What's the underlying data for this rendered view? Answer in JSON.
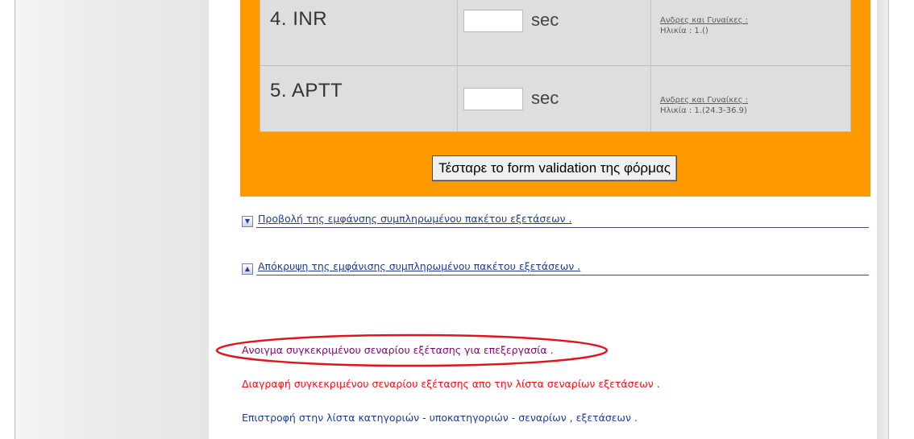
{
  "tests": [
    {
      "number": "4.",
      "name": "INR",
      "value": "",
      "unit": "sec",
      "ref_link": "Ανδρες και Γυναίκες :",
      "ref_range": "Ηλικία :  1.()"
    },
    {
      "number": "5.",
      "name": "APTT",
      "value": "",
      "unit": "sec",
      "ref_link": "Ανδρες και Γυναίκες :",
      "ref_range": "Ηλικία :  1.(24.3-36.9)"
    }
  ],
  "validate_button": "Τέσταρε το form validation της φόρμας",
  "toggles": {
    "show_label": "Προβολή της εμφάνσης συμπληρωμένου πακέτου εξετάσεων .",
    "hide_label": "Απόκρυψη της εμφάνισης συμπληρωμένου πακέτου εξετάσεων ."
  },
  "actions": {
    "open": "Ανοιγμα συγκεκριμένου σεναρίου εξέτασης για επεξεργασία .",
    "delete": "Διαγραφή συγκεκριμένου σεναρίου εξέτασης απο την λίστα σεναρίων εξετάσεων .",
    "back": "Επιστροφή στην λίστα κατηγοριών - υποκατηγοριών - σεναρίων , εξετάσεων ."
  },
  "icons": {
    "expand": "chevron-down-icon",
    "collapse": "chevron-up-icon"
  },
  "colors": {
    "panel": "#ff9900",
    "table": "#dedede",
    "highlight": "#e0141e",
    "open_link": "#7a0a6f",
    "delete_link": "#ee1111",
    "back_link": "#1f3d8a"
  }
}
